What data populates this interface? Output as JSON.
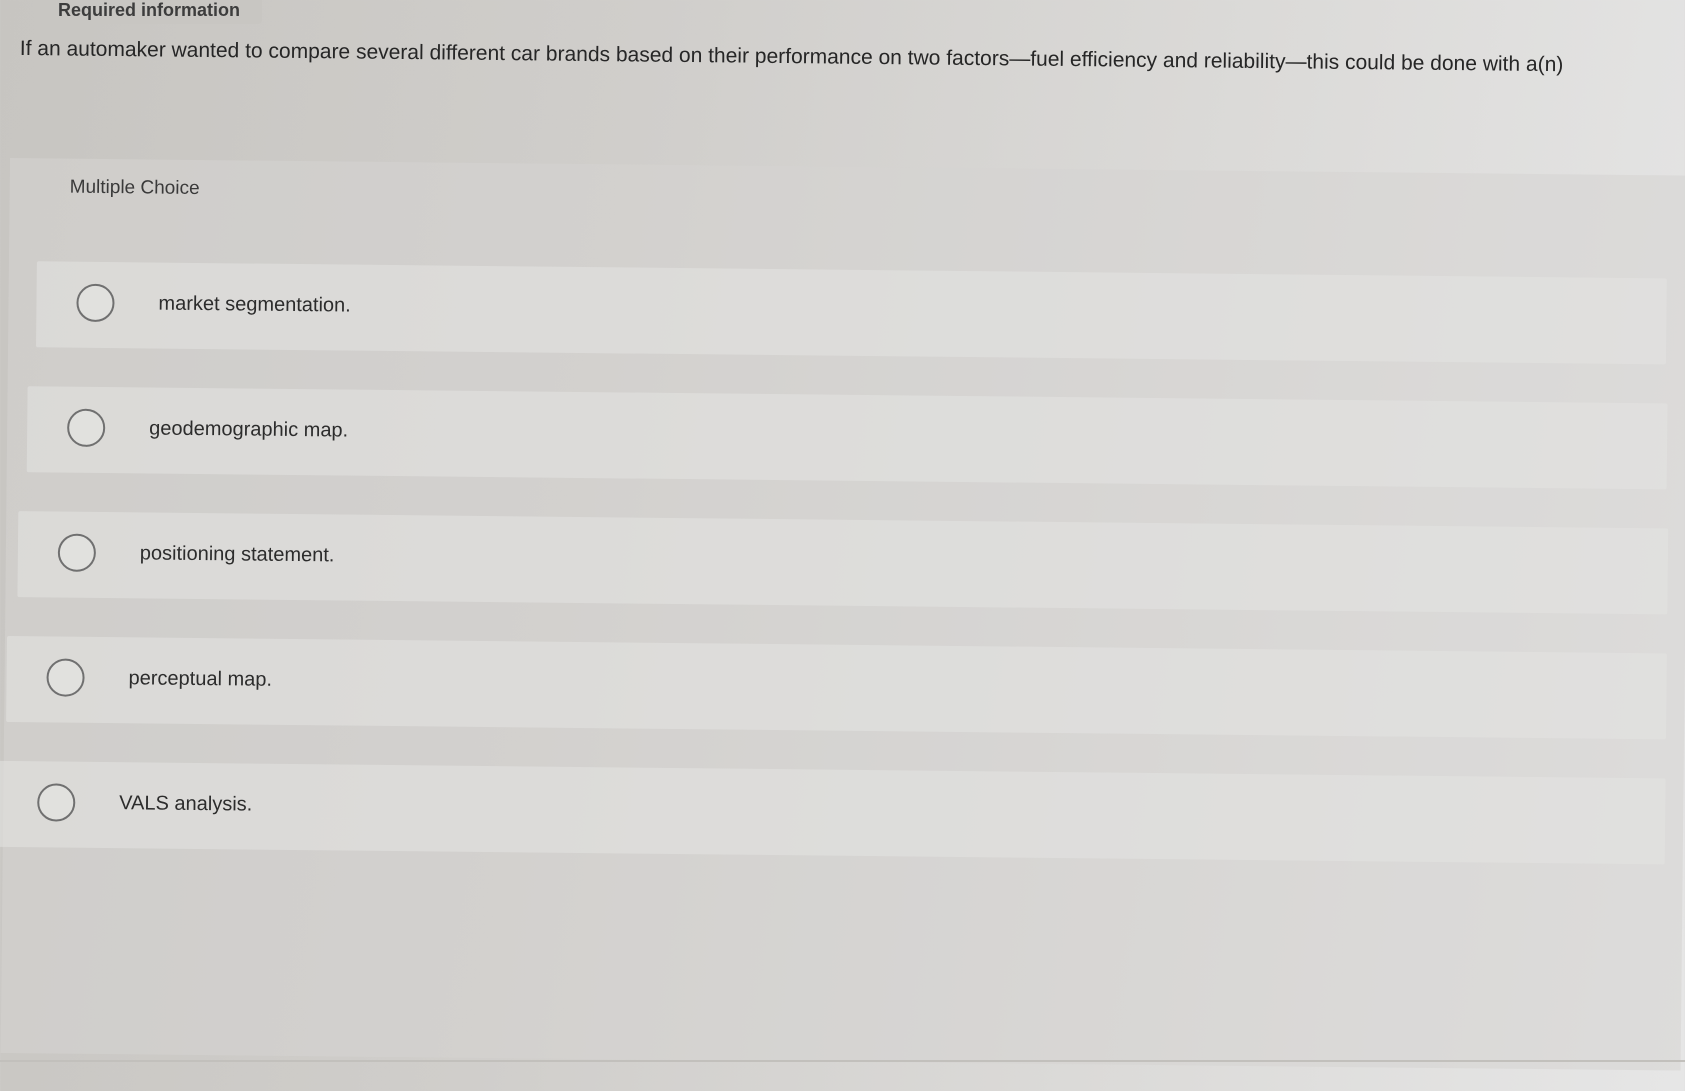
{
  "header": {
    "tab_label": "Required information"
  },
  "question": {
    "text": "If an automaker wanted to compare several different car brands based on their performance on two factors—fuel efficiency and reliability—this could be done with a(n)"
  },
  "choices_block": {
    "type_label": "Multiple Choice",
    "options": [
      {
        "label": "market segmentation."
      },
      {
        "label": "geodemographic map."
      },
      {
        "label": "positioning statement."
      },
      {
        "label": "perceptual map."
      },
      {
        "label": "VALS analysis."
      }
    ]
  }
}
